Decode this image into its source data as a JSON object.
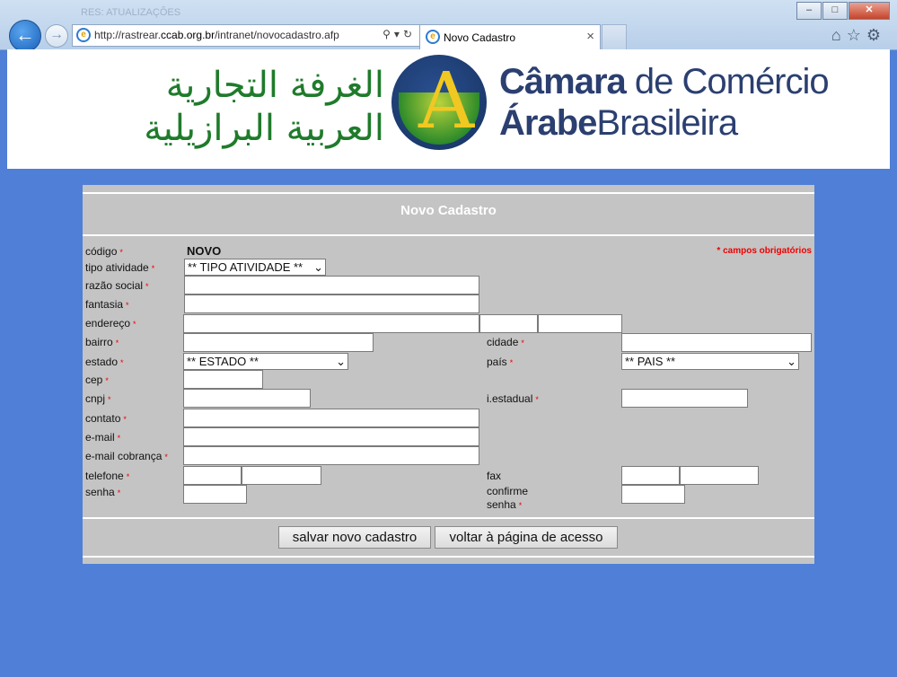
{
  "browser": {
    "url_prefix": "http://rastrear.",
    "url_domain": "ccab.org.br",
    "url_suffix": "/intranet/novocadastro.afp",
    "tab_title": "Novo Cadastro",
    "background_titles": "RES: ATUALIZAÇÕES"
  },
  "banner": {
    "arabic_line1": "الغرفة التجارية",
    "arabic_line2": "العربية البرازيلية",
    "brand_line1_bold": "Câmara",
    "brand_line1_rest": " de Comércio",
    "brand_line2_bold": "Árabe",
    "brand_line2_rest": "Brasileira"
  },
  "form": {
    "title": "Novo Cadastro",
    "required_note": "* campos obrigatórios",
    "required_mark": "*",
    "labels": {
      "codigo": "código",
      "tipo_atividade": "tipo atividade",
      "razao_social": "razão social",
      "fantasia": "fantasia",
      "endereco": "endereço",
      "bairro": "bairro",
      "cidade": "cidade",
      "estado": "estado",
      "pais": "país",
      "cep": "cep",
      "cnpj": "cnpj",
      "ie": "i.estadual",
      "contato": "contato",
      "email": "e-mail",
      "email_cobranca": "e-mail cobrança",
      "telefone": "telefone",
      "fax": "fax",
      "senha": "senha",
      "confirme_1": "confirme",
      "confirme_2": "senha"
    },
    "codigo_value": "NOVO",
    "tipo_atividade_selected": "** TIPO ATIVIDADE **",
    "estado_selected": "** ESTADO **",
    "pais_selected": "** PAIS **",
    "buttons": {
      "save": "salvar novo cadastro",
      "back": "voltar à página de acesso"
    }
  },
  "colors": {
    "page_bg": "#4f7fd6",
    "panel_bg": "#c4c4c4",
    "required": "#ee0000",
    "arabic_green": "#1f7b2b",
    "brand_blue": "#2b3f70"
  }
}
